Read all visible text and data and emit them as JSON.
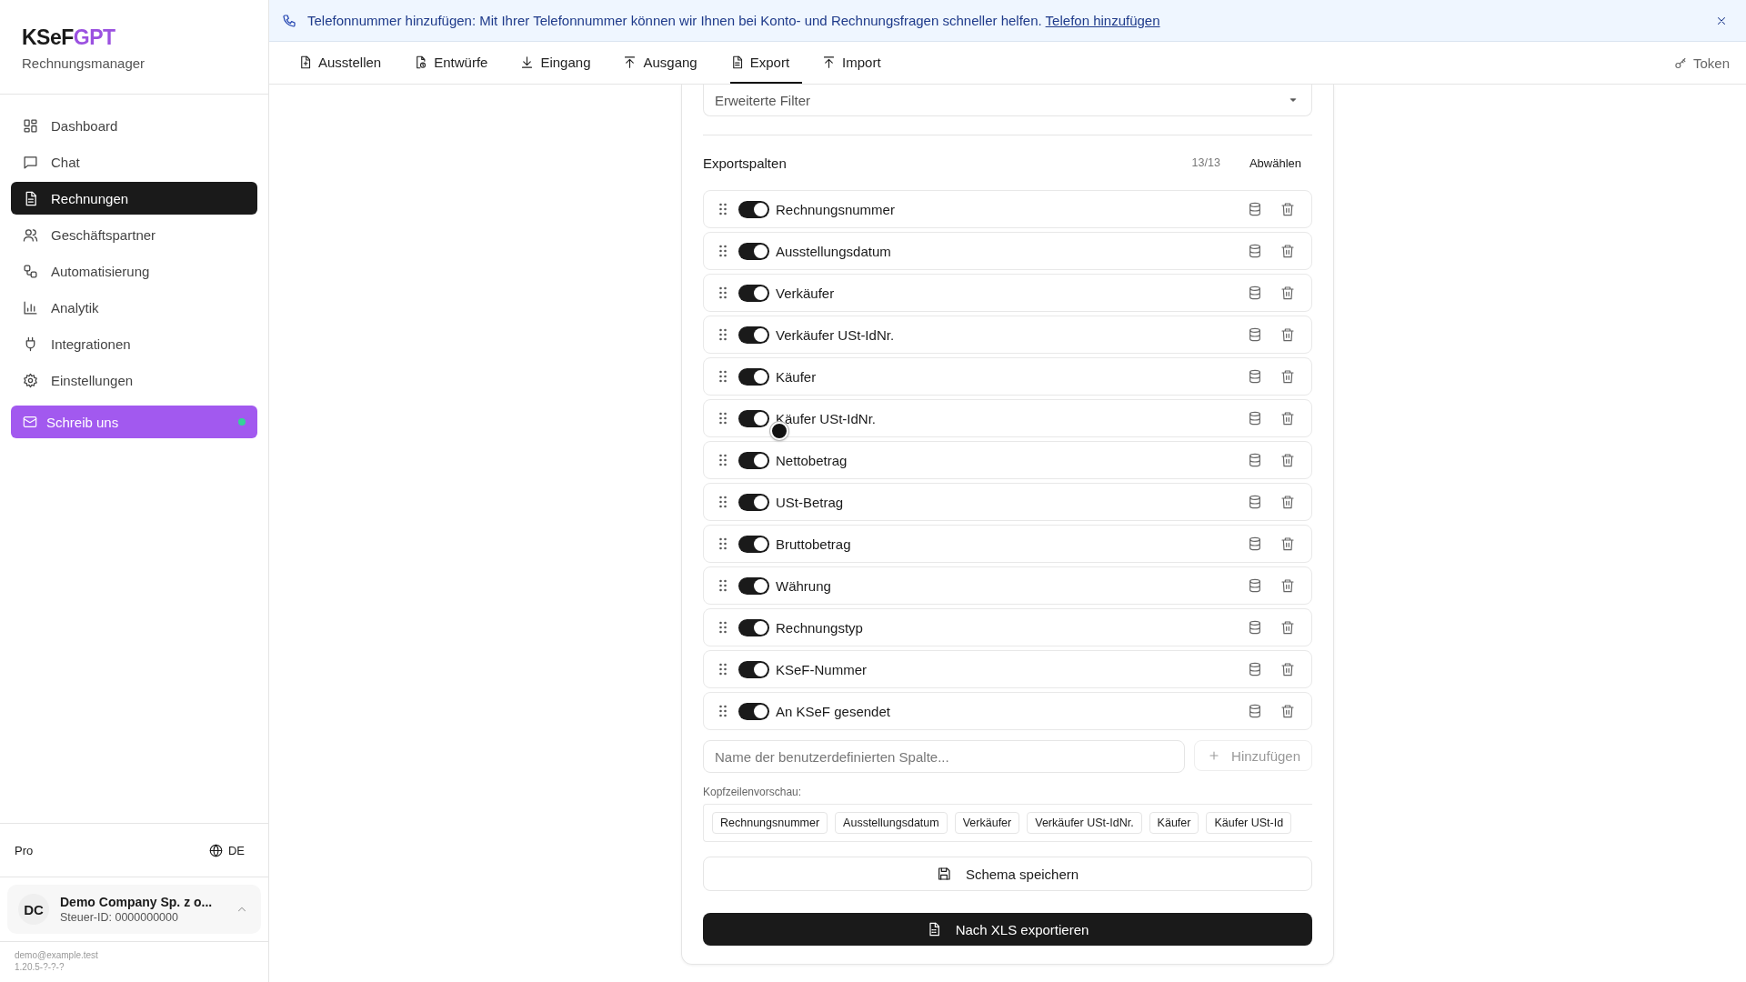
{
  "app": {
    "logo_main": "KSeF",
    "logo_accent": "GPT",
    "subtitle": "Rechnungsmanager"
  },
  "sidebar": {
    "items": [
      {
        "label": "Dashboard",
        "selected": false
      },
      {
        "label": "Chat",
        "selected": false
      },
      {
        "label": "Rechnungen",
        "selected": true
      },
      {
        "label": "Geschäftspartner",
        "selected": false
      },
      {
        "label": "Automatisierung",
        "selected": false
      },
      {
        "label": "Analytik",
        "selected": false
      },
      {
        "label": "Integrationen",
        "selected": false
      },
      {
        "label": "Einstellungen",
        "selected": false
      }
    ],
    "contact_button": {
      "label": "Schreib uns",
      "online": true
    },
    "plan": "Pro",
    "language": "DE",
    "account": {
      "initials": "DC",
      "name": "Demo Company Sp. z o...",
      "tax_id": "Steuer-ID: 0000000000",
      "expanded": false
    },
    "email": "demo@example.test",
    "version": "1.20.5-?-?-?"
  },
  "banner": {
    "text": "Telefonnummer hinzufügen: Mit Ihrer Telefonnummer können wir Ihnen bei Konto- und Rechnungsfragen schneller helfen.",
    "link": "Telefon hinzufügen"
  },
  "tabs": [
    {
      "label": "Ausstellen",
      "selected": false
    },
    {
      "label": "Entwürfe",
      "selected": false
    },
    {
      "label": "Eingang",
      "selected": false
    },
    {
      "label": "Ausgang",
      "selected": false
    },
    {
      "label": "Export",
      "selected": true
    },
    {
      "label": "Import",
      "selected": false
    }
  ],
  "token": "Token",
  "export": {
    "filter": "Erweiterte Filter",
    "title": "Exportspalten",
    "count": "13/13",
    "deselect": "Abwählen",
    "columns": [
      {
        "label": "Rechnungsnummer",
        "on": true
      },
      {
        "label": "Ausstellungsdatum",
        "on": true
      },
      {
        "label": "Verkäufer",
        "on": true
      },
      {
        "label": "Verkäufer USt-IdNr.",
        "on": true
      },
      {
        "label": "Käufer",
        "on": true
      },
      {
        "label": "Käufer USt-IdNr.",
        "on": true
      },
      {
        "label": "Nettobetrag",
        "on": true
      },
      {
        "label": "USt-Betrag",
        "on": true
      },
      {
        "label": "Bruttobetrag",
        "on": true
      },
      {
        "label": "Währung",
        "on": true
      },
      {
        "label": "Rechnungstyp",
        "on": true
      },
      {
        "label": "KSeF-Nummer",
        "on": true
      },
      {
        "label": "An KSeF gesendet",
        "on": true
      }
    ],
    "custom_column": {
      "placeholder": "Name der benutzerdefinierten Spalte..."
    },
    "add_button": {
      "label": "Hinzufügen",
      "disabled": true
    },
    "preview_label": "Kopfzeilenvorschau:",
    "preview": [
      "Rechnungsnummer",
      "Ausstellungsdatum",
      "Verkäufer",
      "Verkäufer USt-IdNr.",
      "Käufer",
      "Käufer USt-Id"
    ],
    "save_button": "Schema speichern",
    "export_button": "Nach XLS exportieren"
  }
}
